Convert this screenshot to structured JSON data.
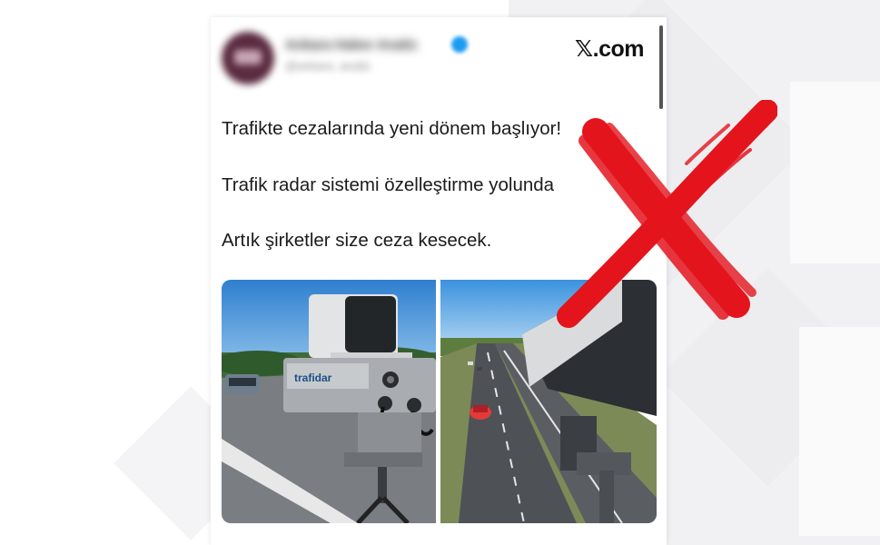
{
  "post": {
    "source_label": "𝕏.com",
    "author_name": "Ankara Haber Analiz",
    "author_handle": "@ankara_analiz",
    "lines": [
      "Trafikte cezalarında yeni dönem başlıyor!",
      "Trafik radar sistemi özelleştirme yolunda",
      "Artık şirketler size ceza kesecek."
    ],
    "left_photo": {
      "device_brand": "trafidar"
    }
  },
  "overlay": {
    "mark": "x-mark",
    "color": "#e4141d"
  },
  "colors": {
    "sky": "#3d8fd6",
    "road": "#6b6e73",
    "accent_red": "#e4141d"
  }
}
